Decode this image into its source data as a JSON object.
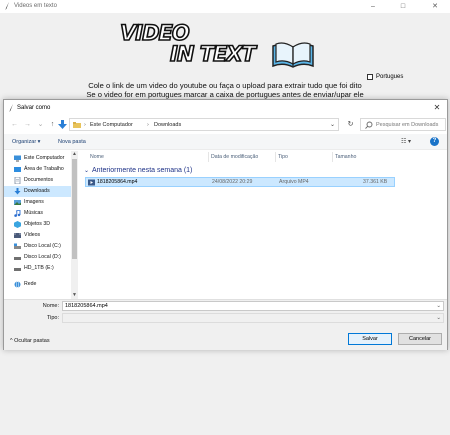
{
  "app": {
    "title": "Videos em texto",
    "controls": {
      "minimize": "–",
      "maximize": "□",
      "close": "✕"
    },
    "logo": {
      "line1": "VIDEO",
      "line2": "IN TEXT"
    },
    "portuguese_checkbox": {
      "label": "Portugues",
      "checked": false
    },
    "instructions": [
      "Cole o link de um video do youtube ou faça o upload para extrair tudo que foi dito",
      "Se o video for em portugues marcar a caixa de portugues antes de enviar/upar ele"
    ]
  },
  "dialog": {
    "title": "Salvar como",
    "close": "✕",
    "nav": {
      "back": "←",
      "forward": "→",
      "recent": "⌄",
      "up": "↑"
    },
    "breadcrumb": [
      "Este Computador",
      "Downloads"
    ],
    "breadcrumb_separator": "›",
    "refresh": "↻",
    "search_placeholder": "Pesquisar em Downloads",
    "command_bar": {
      "organize": "Organizar ▾",
      "new_folder": "Nova pasta",
      "view": "☷ ▾",
      "help": "?"
    },
    "sidebar": [
      {
        "label": "Este Computador",
        "icon": "computer-icon",
        "color": "#3a8fd9"
      },
      {
        "label": "Área de Trabalho",
        "icon": "desktop-icon",
        "color": "#2d8de0"
      },
      {
        "label": "Documentos",
        "icon": "documents-icon",
        "color": "#7a8aa0"
      },
      {
        "label": "Downloads",
        "icon": "download-icon",
        "color": "#2a7fd6",
        "selected": true
      },
      {
        "label": "Imagens",
        "icon": "pictures-icon",
        "color": "#5aa0d8"
      },
      {
        "label": "Músicas",
        "icon": "music-icon",
        "color": "#2d6fd0"
      },
      {
        "label": "Objetos 3D",
        "icon": "objects-3d-icon",
        "color": "#3aa5e0"
      },
      {
        "label": "Vídeos",
        "icon": "videos-icon",
        "color": "#4a5a7a"
      },
      {
        "label": "Disco Local (C:)",
        "icon": "drive-icon",
        "color": "#6a8ab0"
      },
      {
        "label": "Disco Local (D:)",
        "icon": "drive-icon",
        "color": "#707070"
      },
      {
        "label": "HD_1TB (E:)",
        "icon": "drive-icon",
        "color": "#707070"
      },
      {
        "label": "Rede",
        "icon": "network-icon",
        "color": "#3a8fd9"
      }
    ],
    "columns": {
      "name": "Nome",
      "modified": "Data de modificação",
      "type": "Tipo",
      "size": "Tamanho"
    },
    "group": {
      "label": "Anteriormente nesta semana (1)",
      "chevron": "⌄"
    },
    "files": [
      {
        "name": "1818205864.mp4",
        "modified": "24/08/2022 20:29",
        "type": "Arquivo MP4",
        "size": "37.361 KB"
      }
    ],
    "filename_label": "Nome:",
    "filename_value": "1818205864.mp4",
    "type_label": "Tipo:",
    "type_value": "",
    "hide_folders": "Ocultar pastas",
    "save_button": "Salvar",
    "cancel_button": "Cancelar",
    "accent_color": "#0078d7"
  }
}
